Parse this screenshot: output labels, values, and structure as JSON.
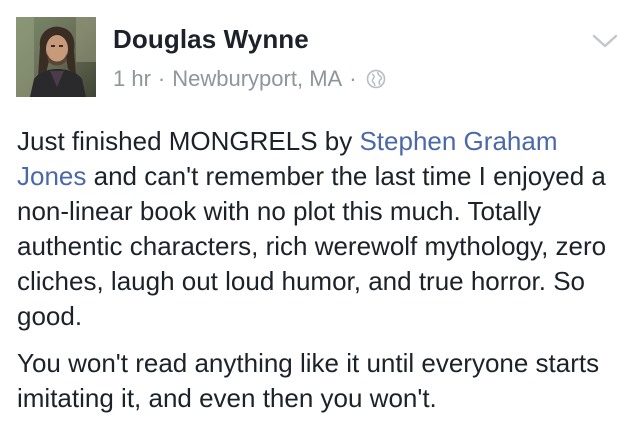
{
  "post": {
    "author": "Douglas Wynne",
    "time": "1 hr",
    "separator": "·",
    "location": "Newburyport, MA",
    "privacy_icon": "globe-icon",
    "menu_icon": "chevron-down-icon",
    "colors": {
      "text": "#1d2129",
      "meta": "#90949c",
      "link": "#4b68a8"
    },
    "paragraph1": {
      "text_before": "Just finished MONGRELS by ",
      "link_text": "Stephen Graham Jones",
      "text_after": " and can't remember the last time I enjoyed a non-linear book with no plot this much. Totally authentic characters, rich werewolf mythology, zero cliches, laugh out loud humor, and true horror. So good."
    },
    "paragraph2": "You won't read anything like it until everyone starts imitating it, and even then you won't."
  }
}
